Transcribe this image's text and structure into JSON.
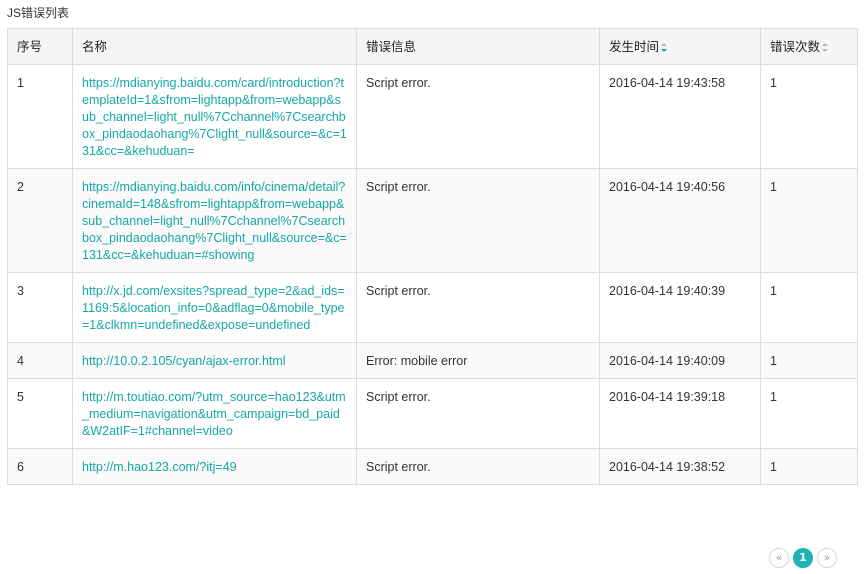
{
  "section_title": "JS错误列表",
  "columns": {
    "index": "序号",
    "name": "名称",
    "message": "错误信息",
    "time": "发生时间",
    "count": "错误次数"
  },
  "rows": [
    {
      "index": "1",
      "name": "https://mdianying.baidu.com/card/introduction?templateId=1&sfrom=lightapp&from=webapp&sub_channel=light_null%7Cchannel%7Csearchbox_pindaodaohang%7Clight_null&source=&c=131&cc=&kehuduan=",
      "message": "Script error.",
      "time": "2016-04-14 19:43:58",
      "count": "1"
    },
    {
      "index": "2",
      "name": "https://mdianying.baidu.com/info/cinema/detail?cinemaId=148&sfrom=lightapp&from=webapp&sub_channel=light_null%7Cchannel%7Csearchbox_pindaodaohang%7Clight_null&source=&c=131&cc=&kehuduan=#showing",
      "message": "Script error.",
      "time": "2016-04-14 19:40:56",
      "count": "1"
    },
    {
      "index": "3",
      "name": "http://x.jd.com/exsites?spread_type=2&ad_ids=1169:5&location_info=0&adflag=0&mobile_type=1&clkmn=undefined&expose=undefined",
      "message": "Script error.",
      "time": "2016-04-14 19:40:39",
      "count": "1"
    },
    {
      "index": "4",
      "name": "http://10.0.2.105/cyan/ajax-error.html",
      "message": "Error: mobile error",
      "time": "2016-04-14 19:40:09",
      "count": "1"
    },
    {
      "index": "5",
      "name": "http://m.toutiao.com/?utm_source=hao123&utm_medium=navigation&utm_campaign=bd_paid&W2atIF=1#channel=video",
      "message": "Script error.",
      "time": "2016-04-14 19:39:18",
      "count": "1"
    },
    {
      "index": "6",
      "name": "http://m.hao123.com/?itj=49",
      "message": "Script error.",
      "time": "2016-04-14 19:38:52",
      "count": "1"
    }
  ],
  "pagination": {
    "prev": "«",
    "current": "1",
    "next": "»"
  }
}
